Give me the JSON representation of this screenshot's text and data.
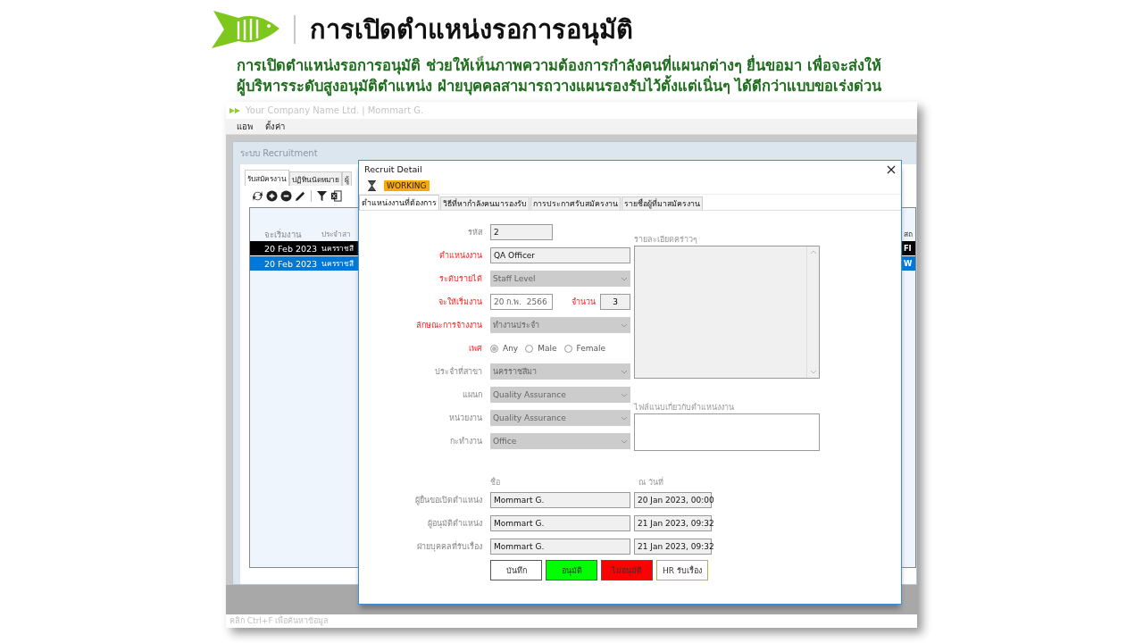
{
  "slide": {
    "title": "การเปิดตำแหน่งรอการอนุมัติ",
    "description": "การเปิดตำแหน่งรอการอนุมัติ ช่วยให้เห็นภาพความต้องการกำลังคนที่แผนกต่างๆ ยื่นขอมา เพื่อจะส่งให้ผู้บริหารระดับสูงอนุมัติตำแหน่ง ฝ่ายบุคคลสามารถวางแผนรองรับไว้ตั้งแต่เนิ่นๆ ได้ดีกว่าแบบขอเร่งด่วน"
  },
  "app": {
    "title_bar": "Your Company Name Ltd. | Mommart G.",
    "menu": [
      "แอพ",
      "ตั้งค่า"
    ],
    "main_window": {
      "title": "ระบบ Recruitment",
      "tabs": [
        {
          "label": "รับสมัครงาน",
          "selected": true
        },
        {
          "label": "ปฏิทินนัดหมาย",
          "selected": false
        },
        {
          "label": "ผู้",
          "selected": false
        }
      ],
      "grid": {
        "columns": [
          "จะเริ่มงาน",
          "ประจำสา",
          "สถ"
        ],
        "rows": [
          {
            "cells": [
              "20 Feb 2023",
              "นครราชสี",
              "FI"
            ],
            "color": "#000000"
          },
          {
            "cells": [
              "20 Feb 2023",
              "นครราชสี",
              "W"
            ],
            "color": "#0078d7"
          }
        ]
      }
    },
    "status_bar": "คลิก Ctrl+F เพื่อค้นหาข้อมูล"
  },
  "dialog": {
    "title": "Recruit Detail",
    "status_badge": "WORKING",
    "tabs": [
      {
        "label": "ตำแหน่งงานที่ต้องการ",
        "selected": true
      },
      {
        "label": "วิธีที่หากำลังคนมารองรับ",
        "selected": false
      },
      {
        "label": "การประกาศรับสมัครงาน",
        "selected": false
      },
      {
        "label": "รายชื่อผู้ที่มาสมัครงาน",
        "selected": false
      }
    ],
    "fields": [
      {
        "kind": "short_text",
        "label": "รหัส",
        "required": false,
        "value": "2"
      },
      {
        "kind": "text",
        "label": "ตำแหน่งงาน",
        "required": true,
        "value": "QA Officer"
      },
      {
        "kind": "combo",
        "label": "ระดับรายได้",
        "required": true,
        "value": "Staff Level"
      },
      {
        "kind": "date",
        "label": "จะให้เริ่มงาน",
        "required": true,
        "value": "20 ก.พ.  2566",
        "count_label": "จำนวน",
        "count_value": "3"
      },
      {
        "kind": "combo",
        "label": "ลักษณะการจ้างงาน",
        "required": true,
        "value": "ทำงานประจำ"
      },
      {
        "kind": "radio",
        "label": "เพศ",
        "required": true,
        "options": [
          {
            "label": "Any",
            "selected": true
          },
          {
            "label": "Male",
            "selected": false
          },
          {
            "label": "Female",
            "selected": false
          }
        ]
      },
      {
        "kind": "combo",
        "label": "ประจำที่สาขา",
        "required": false,
        "value": "นครราชสีมา"
      },
      {
        "kind": "combo",
        "label": "แผนก",
        "required": false,
        "value": "Quality Assurance"
      },
      {
        "kind": "combo",
        "label": "หน่วยงาน",
        "required": false,
        "value": "Quality Assurance"
      },
      {
        "kind": "combo",
        "label": "กะทำงาน",
        "required": false,
        "value": "Office"
      }
    ],
    "notes_label": "รายละเอียดคร่าวๆ",
    "attachment_label": "ไฟล์แนบเกี่ยวกับตำแหน่งงาน",
    "approvals": {
      "columns": [
        "ชื่อ",
        "ณ วันที่"
      ],
      "rows": [
        {
          "label": "ผู้ยื่นขอเปิดตำแหน่ง",
          "name": "Mommart G.",
          "date": "20 Jan 2023, 00:00"
        },
        {
          "label": "ผู้อนุมัติตำแหน่ง",
          "name": "Mommart G.",
          "date": "21 Jan 2023, 09:32"
        },
        {
          "label": "ฝ่ายบุคคลที่รับเรื่อง",
          "name": "Mommart G.",
          "date": "21 Jan 2023, 09:32"
        }
      ]
    },
    "buttons": [
      {
        "label": "บันทึก",
        "color": "#ffffff"
      },
      {
        "label": "อนุมัติ",
        "color": "#00ff00"
      },
      {
        "label": "ไม่อนุมัติ",
        "color": "#ff0000"
      },
      {
        "label": "HR รับเรื่อง",
        "color": "#ffffff"
      }
    ]
  }
}
